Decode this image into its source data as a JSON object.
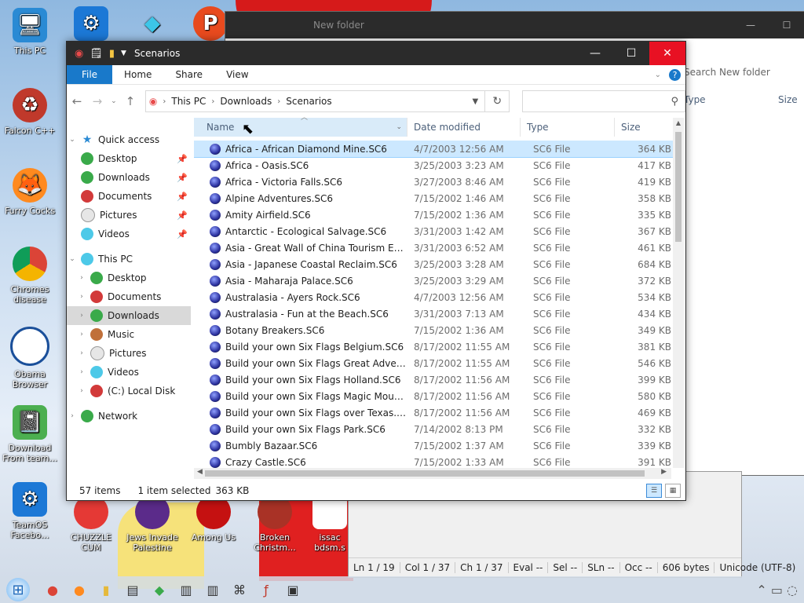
{
  "desktop": {
    "icons": [
      {
        "label": "This PC",
        "icon": "monitor-icon"
      },
      {
        "label": "Falcon C++",
        "icon": "recycle-icon"
      },
      {
        "label": "Furry Cocks",
        "icon": "firefox-icon"
      },
      {
        "label": "Chromes disease",
        "icon": "chrome-icon"
      },
      {
        "label": "Obama Browser",
        "icon": "obama-logo-icon"
      },
      {
        "label": "Download From team...",
        "icon": "notebook-icon"
      },
      {
        "label": "TeamOS Facebo...",
        "icon": "gear-icon"
      },
      {
        "label": "CHUZZLE CUM",
        "icon": "chuzzle-icon"
      },
      {
        "label": "Jews Invade Palestine",
        "icon": "game-icon"
      },
      {
        "label": "Among Us",
        "icon": "among-us-icon"
      },
      {
        "label": "Broken Christm...",
        "icon": "game-icon"
      },
      {
        "label": "issac bdsm.s",
        "icon": "game-icon"
      }
    ]
  },
  "background_window": {
    "title": "New folder",
    "search_placeholder": "Search New folder",
    "col_type": "Type",
    "col_size": "Size"
  },
  "notepad_status": {
    "ln": "Ln 1 / 19",
    "col": "Col 1 / 37",
    "ch": "Ch 1 / 37",
    "eval": "Eval --",
    "sel": "Sel --",
    "sln": "SLn --",
    "occ": "Occ --",
    "bytes": "606 bytes",
    "encoding": "Unicode (UTF-8)"
  },
  "explorer": {
    "title": "Scenarios",
    "ribbon": {
      "file": "File",
      "home": "Home",
      "share": "Share",
      "view": "View"
    },
    "breadcrumb": [
      "This PC",
      "Downloads",
      "Scenarios"
    ],
    "search_placeholder": "",
    "nav": {
      "quick_access": "Quick access",
      "quick_items": [
        "Desktop",
        "Downloads",
        "Documents",
        "Pictures",
        "Videos"
      ],
      "this_pc": "This PC",
      "pc_items": [
        "Desktop",
        "Documents",
        "Downloads",
        "Music",
        "Pictures",
        "Videos",
        "(C:) Local Disk"
      ],
      "network": "Network"
    },
    "columns": {
      "name": "Name",
      "date": "Date modified",
      "type": "Type",
      "size": "Size"
    },
    "files": [
      {
        "name": "Africa - African Diamond Mine.SC6",
        "date": "4/7/2003 12:56 AM",
        "type": "SC6 File",
        "size": "364 KB"
      },
      {
        "name": "Africa - Oasis.SC6",
        "date": "3/25/2003 3:23 AM",
        "type": "SC6 File",
        "size": "417 KB"
      },
      {
        "name": "Africa - Victoria Falls.SC6",
        "date": "3/27/2003 8:46 AM",
        "type": "SC6 File",
        "size": "419 KB"
      },
      {
        "name": "Alpine Adventures.SC6",
        "date": "7/15/2002 1:46 AM",
        "type": "SC6 File",
        "size": "358 KB"
      },
      {
        "name": "Amity Airfield.SC6",
        "date": "7/15/2002 1:36 AM",
        "type": "SC6 File",
        "size": "335 KB"
      },
      {
        "name": "Antarctic - Ecological Salvage.SC6",
        "date": "3/31/2003 1:42 AM",
        "type": "SC6 File",
        "size": "367 KB"
      },
      {
        "name": "Asia - Great Wall of China Tourism Enhan...",
        "date": "3/31/2003 6:52 AM",
        "type": "SC6 File",
        "size": "461 KB"
      },
      {
        "name": "Asia - Japanese Coastal Reclaim.SC6",
        "date": "3/25/2003 3:28 AM",
        "type": "SC6 File",
        "size": "684 KB"
      },
      {
        "name": "Asia - Maharaja Palace.SC6",
        "date": "3/25/2003 3:29 AM",
        "type": "SC6 File",
        "size": "372 KB"
      },
      {
        "name": "Australasia - Ayers Rock.SC6",
        "date": "4/7/2003 12:56 AM",
        "type": "SC6 File",
        "size": "534 KB"
      },
      {
        "name": "Australasia - Fun at the Beach.SC6",
        "date": "3/31/2003 7:13 AM",
        "type": "SC6 File",
        "size": "434 KB"
      },
      {
        "name": "Botany Breakers.SC6",
        "date": "7/15/2002 1:36 AM",
        "type": "SC6 File",
        "size": "349 KB"
      },
      {
        "name": "Build your own Six Flags Belgium.SC6",
        "date": "8/17/2002 11:55 AM",
        "type": "SC6 File",
        "size": "381 KB"
      },
      {
        "name": "Build your own Six Flags Great Adventure...",
        "date": "8/17/2002 11:55 AM",
        "type": "SC6 File",
        "size": "546 KB"
      },
      {
        "name": "Build your own Six Flags Holland.SC6",
        "date": "8/17/2002 11:56 AM",
        "type": "SC6 File",
        "size": "399 KB"
      },
      {
        "name": "Build your own Six Flags Magic Mountai...",
        "date": "8/17/2002 11:56 AM",
        "type": "SC6 File",
        "size": "580 KB"
      },
      {
        "name": "Build your own Six Flags over Texas.SC6",
        "date": "8/17/2002 11:56 AM",
        "type": "SC6 File",
        "size": "469 KB"
      },
      {
        "name": "Build your own Six Flags Park.SC6",
        "date": "7/14/2002 8:13 PM",
        "type": "SC6 File",
        "size": "332 KB"
      },
      {
        "name": "Bumbly Bazaar.SC6",
        "date": "7/15/2002 1:37 AM",
        "type": "SC6 File",
        "size": "339 KB"
      },
      {
        "name": "Crazy Castle.SC6",
        "date": "7/15/2002 1:33 AM",
        "type": "SC6 File",
        "size": "391 KB"
      }
    ],
    "selected_index": 0,
    "status": {
      "items": "57 items",
      "selected": "1 item selected",
      "size": "363 KB"
    }
  }
}
